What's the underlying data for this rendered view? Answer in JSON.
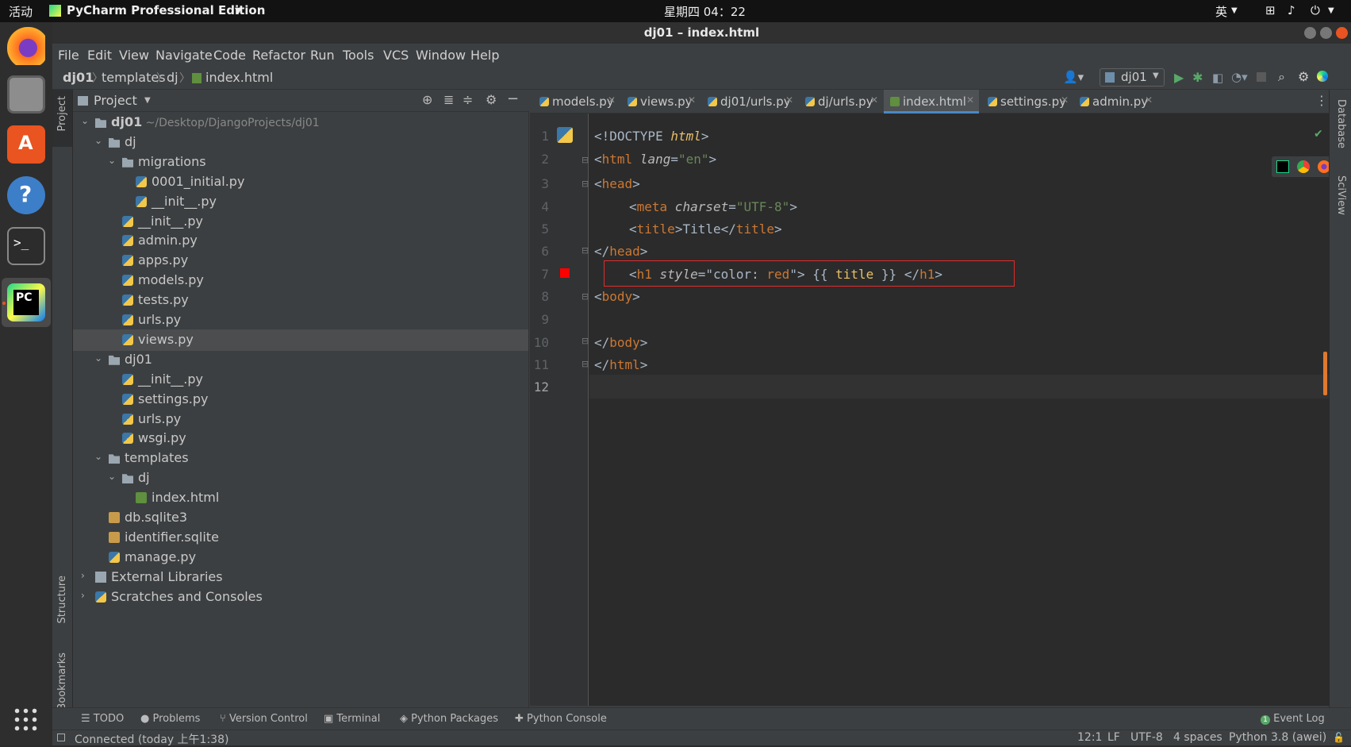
{
  "topbar": {
    "activities": "活动",
    "app_name": "PyCharm Professional Edition",
    "clock": "星期四 04：22",
    "input_method": "英"
  },
  "window": {
    "title": "dj01 – index.html"
  },
  "menu": [
    "File",
    "Edit",
    "View",
    "Navigate",
    "Code",
    "Refactor",
    "Run",
    "Tools",
    "VCS",
    "Window",
    "Help"
  ],
  "breadcrumb": [
    "dj01",
    "templates",
    "dj",
    "index.html"
  ],
  "run_config": "dj01",
  "project_panel": {
    "title": "Project",
    "tree": [
      {
        "label": "dj01",
        "suffix": "~/Desktop/DjangoProjects/dj01",
        "indent": 0,
        "type": "folder",
        "arrow": "v",
        "bold": true
      },
      {
        "label": "dj",
        "indent": 1,
        "type": "folder",
        "arrow": "v"
      },
      {
        "label": "migrations",
        "indent": 2,
        "type": "folder",
        "arrow": "v"
      },
      {
        "label": "0001_initial.py",
        "indent": 3,
        "type": "py"
      },
      {
        "label": "__init__.py",
        "indent": 3,
        "type": "py"
      },
      {
        "label": "__init__.py",
        "indent": 2,
        "type": "py"
      },
      {
        "label": "admin.py",
        "indent": 2,
        "type": "py"
      },
      {
        "label": "apps.py",
        "indent": 2,
        "type": "py"
      },
      {
        "label": "models.py",
        "indent": 2,
        "type": "py"
      },
      {
        "label": "tests.py",
        "indent": 2,
        "type": "py"
      },
      {
        "label": "urls.py",
        "indent": 2,
        "type": "py"
      },
      {
        "label": "views.py",
        "indent": 2,
        "type": "py",
        "selected": true
      },
      {
        "label": "dj01",
        "indent": 1,
        "type": "folder",
        "arrow": "v"
      },
      {
        "label": "__init__.py",
        "indent": 2,
        "type": "py"
      },
      {
        "label": "settings.py",
        "indent": 2,
        "type": "py"
      },
      {
        "label": "urls.py",
        "indent": 2,
        "type": "py"
      },
      {
        "label": "wsgi.py",
        "indent": 2,
        "type": "py"
      },
      {
        "label": "templates",
        "indent": 1,
        "type": "folder",
        "arrow": "v"
      },
      {
        "label": "dj",
        "indent": 2,
        "type": "folder",
        "arrow": "v"
      },
      {
        "label": "index.html",
        "indent": 3,
        "type": "html"
      },
      {
        "label": "db.sqlite3",
        "indent": 1,
        "type": "db"
      },
      {
        "label": "identifier.sqlite",
        "indent": 1,
        "type": "db"
      },
      {
        "label": "manage.py",
        "indent": 1,
        "type": "py"
      },
      {
        "label": "External Libraries",
        "indent": 0,
        "type": "lib",
        "arrow": ">"
      },
      {
        "label": "Scratches and Consoles",
        "indent": 0,
        "type": "scratch",
        "arrow": ">"
      }
    ]
  },
  "left_strip": {
    "project": "Project",
    "structure": "Structure",
    "bookmarks": "Bookmarks"
  },
  "right_strip": {
    "database": "Database",
    "sciview": "SciView"
  },
  "tabs": [
    {
      "label": "models.py",
      "active": false
    },
    {
      "label": "views.py",
      "active": false
    },
    {
      "label": "dj01/urls.py",
      "active": false
    },
    {
      "label": "dj/urls.py",
      "active": false
    },
    {
      "label": "index.html",
      "active": true
    },
    {
      "label": "settings.py",
      "active": false
    },
    {
      "label": "admin.py",
      "active": false
    }
  ],
  "code_lines": [
    "1",
    "2",
    "3",
    "4",
    "5",
    "6",
    "7",
    "8",
    "9",
    "10",
    "11",
    "12"
  ],
  "code": {
    "l1a": "<!DOCTYPE ",
    "l1b": "html",
    "l1c": ">",
    "l2a": "<",
    "l2b": "html",
    "l2c": " lang",
    "l2d": "=",
    "l2e": "\"en\"",
    "l2f": ">",
    "l3a": "<",
    "l3b": "head",
    "l3c": ">",
    "l4a": "<",
    "l4b": "meta",
    "l4c": " charset",
    "l4d": "=",
    "l4e": "\"UTF-8\"",
    "l4f": ">",
    "l5a": "<",
    "l5b": "title",
    "l5c": ">Title</",
    "l5d": "title",
    "l5e": ">",
    "l6a": "</",
    "l6b": "head",
    "l6c": ">",
    "l7a": "<",
    "l7b": "h1",
    "l7c": " style",
    "l7d": "=\"color: ",
    "l7e": "red",
    "l7f": "\"> {{ ",
    "l7g": "title",
    "l7h": " }} </",
    "l7i": "h1",
    "l7j": ">",
    "l8a": "<",
    "l8b": "body",
    "l8c": ">",
    "l10a": "</",
    "l10b": "body",
    "l10c": ">",
    "l11a": "</",
    "l11b": "html",
    "l11c": ">"
  },
  "bottom_tools": [
    "TODO",
    "Problems",
    "Version Control",
    "Terminal",
    "Python Packages",
    "Python Console"
  ],
  "event_log": {
    "count": "1",
    "label": "Event Log"
  },
  "status": {
    "left": "Connected (today 上午1:38)",
    "position": "12:1",
    "line_sep": "LF",
    "encoding": "UTF-8",
    "indent": "4 spaces",
    "interpreter": "Python 3.8 (awei)"
  }
}
